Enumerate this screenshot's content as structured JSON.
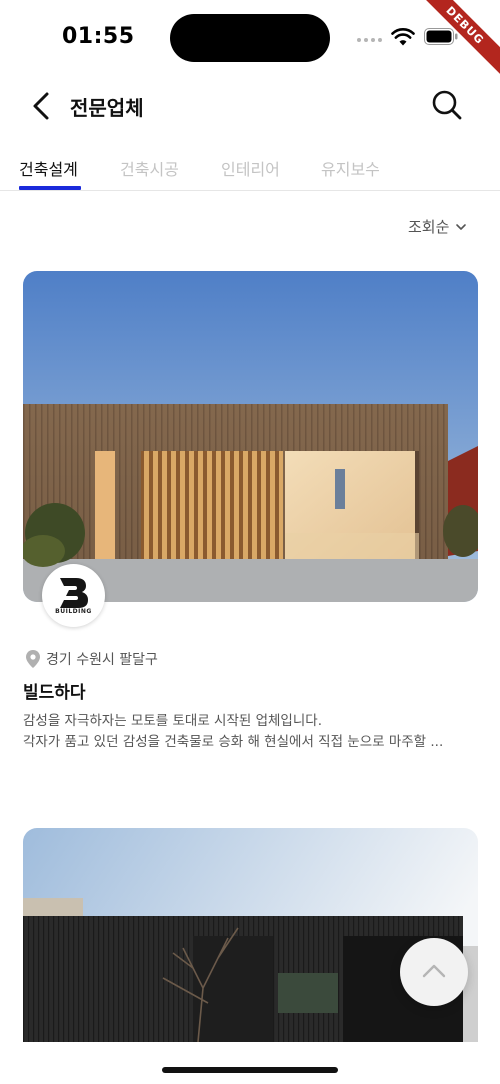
{
  "status_bar": {
    "time": "01:55",
    "debug_label": "DEBUG"
  },
  "header": {
    "title": "전문업체"
  },
  "tabs": [
    {
      "label": "건축설계",
      "active": true
    },
    {
      "label": "건축시공",
      "active": false
    },
    {
      "label": "인테리어",
      "active": false
    },
    {
      "label": "유지보수",
      "active": false
    }
  ],
  "sort": {
    "label": "조회순"
  },
  "cards": [
    {
      "logo_text": "BUILDING",
      "location": "경기 수원시 팔달구",
      "title": "빌드하다",
      "description_line1": "감성을 자극하자는 모토를 토대로 시작된 업체입니다.",
      "description_line2": "각자가 품고 있던 감성을 건축물로 승화 해 현실에서 직접 눈으로 마주할 ..."
    }
  ],
  "colors": {
    "accent": "#1a2adb",
    "inactive_tab": "#c4c4c4",
    "debug": "#b3261e"
  },
  "icons": [
    "back-arrow-icon",
    "search-icon",
    "chevron-down-icon",
    "location-pin-icon",
    "chevron-up-icon",
    "wifi-icon",
    "battery-icon"
  ]
}
